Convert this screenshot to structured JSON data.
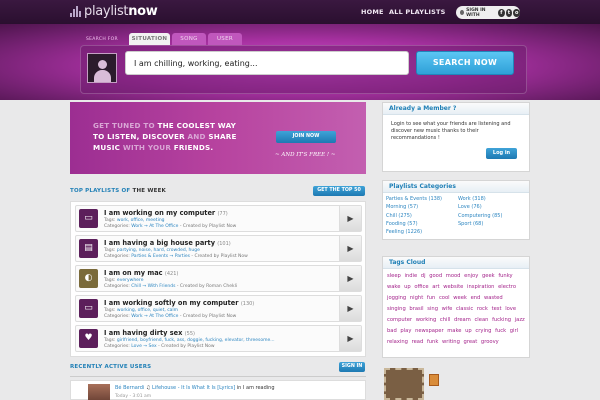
{
  "header": {
    "logo_thin": "playlist",
    "logo_bold": "now",
    "nav_home": "HOME",
    "nav_all": "ALL PLAYLISTS",
    "sign_in_with": "SIGN IN WITH"
  },
  "hero": {
    "search_for": "SEARCH FOR",
    "tabs": [
      {
        "label": "SITUATION",
        "active": true
      },
      {
        "label": "SONG",
        "active": false
      },
      {
        "label": "USER",
        "active": false
      }
    ],
    "search_value": "I am chilling, working, eating...",
    "search_button": "SEARCH NOW"
  },
  "banner": {
    "line1_dim": "GET TUNED TO",
    "line1_bright": "THE COOLEST WAY",
    "line2_bright": "TO LISTEN, DISCOVER",
    "line2_dim": "AND",
    "line2_bright2": "SHARE",
    "line3_bright": "MUSIC",
    "line3_dim": "WITH YOUR",
    "line3_bright2": "FRIENDS.",
    "join_button": "JOIN NOW",
    "free_text": "~ AND IT'S FREE ! ~"
  },
  "playlists": {
    "title_blue": "TOP PLAYLISTS OF",
    "title_dark": "THE WEEK",
    "top50_button": "GET THE TOP 50",
    "tags_label": "Tags:",
    "cats_label": "Categories:",
    "items": [
      {
        "icon": "▭",
        "title": "I am working on my computer",
        "count": "(77)",
        "tags": "work, office, meeting",
        "cats": "Work → At The Office",
        "created": "- Created by Playlist Now"
      },
      {
        "icon": "▤",
        "title": "I am having a big house party",
        "count": "(101)",
        "tags": "partying, noise, hard, crowded, huge",
        "cats": "Parties & Events → Parties",
        "created": "- Created by Playlist Now"
      },
      {
        "icon": "◐",
        "title": "I am on my mac",
        "count": "(421)",
        "tags": "everywhere",
        "cats": "Chill → With Friends",
        "created": "- Created by Roman Chekli"
      },
      {
        "icon": "▭",
        "title": "I am working softly on my computer",
        "count": "(130)",
        "tags": "working, office, quiet, calm",
        "cats": "Work → At The Office",
        "created": "- Created by Playlist Now"
      },
      {
        "icon": "♥",
        "title": "I am having dirty sex",
        "count": "(55)",
        "tags": "girlfriend, boyfriend, fuck, ass, doggie, fucking, elevator, threesome...",
        "cats": "Love → Sex",
        "created": "- Created by Playlist Now"
      }
    ]
  },
  "active_users": {
    "title": "RECENTLY ACTIVE USERS",
    "sign_in_button": "SIGN IN",
    "user_name": "Bé Bernardi",
    "listening_icon": "♫",
    "track": "Lifehouse - It Is What It Is [Lyrics]",
    "in_text": "in",
    "status": "I am reading",
    "time": "Today - 3:01 am"
  },
  "member_panel": {
    "title": "Already a Member ?",
    "text": "Login to see what your friends are listening and discover new music thanks to their recommandations !",
    "login_button": "Log in"
  },
  "categories_panel": {
    "title": "Playlists Categories",
    "left": [
      "Parties & Events (138)",
      "Morning (57)",
      "Chill (275)",
      "Fooding (57)",
      "Feeling (1226)"
    ],
    "right": [
      "Work (318)",
      "Love (76)",
      "Computering (85)",
      "Sport (68)"
    ]
  },
  "tags_panel": {
    "title": "Tags Cloud",
    "tags": [
      "sleep",
      "indie",
      "dj",
      "good",
      "mood",
      "enjoy",
      "geek",
      "funky",
      "wake",
      "up",
      "office",
      "art",
      "website",
      "inspiration",
      "electro",
      "jogging",
      "night",
      "fun",
      "cool",
      "week",
      "end",
      "wasted",
      "singing",
      "brasil",
      "sing",
      "wife",
      "classic",
      "rock",
      "test",
      "love",
      "computer",
      "working",
      "chill",
      "dream",
      "clean",
      "fucking",
      "jazz",
      "bad",
      "play",
      "newspaper",
      "make",
      "up",
      "crying",
      "fuck",
      "girl",
      "relaxing",
      "read",
      "funk",
      "writing",
      "great",
      "groovy"
    ]
  },
  "colors": {
    "accent": "#1f7fb6",
    "brand": "#a5309f",
    "topbar": "#2a0f2f"
  }
}
